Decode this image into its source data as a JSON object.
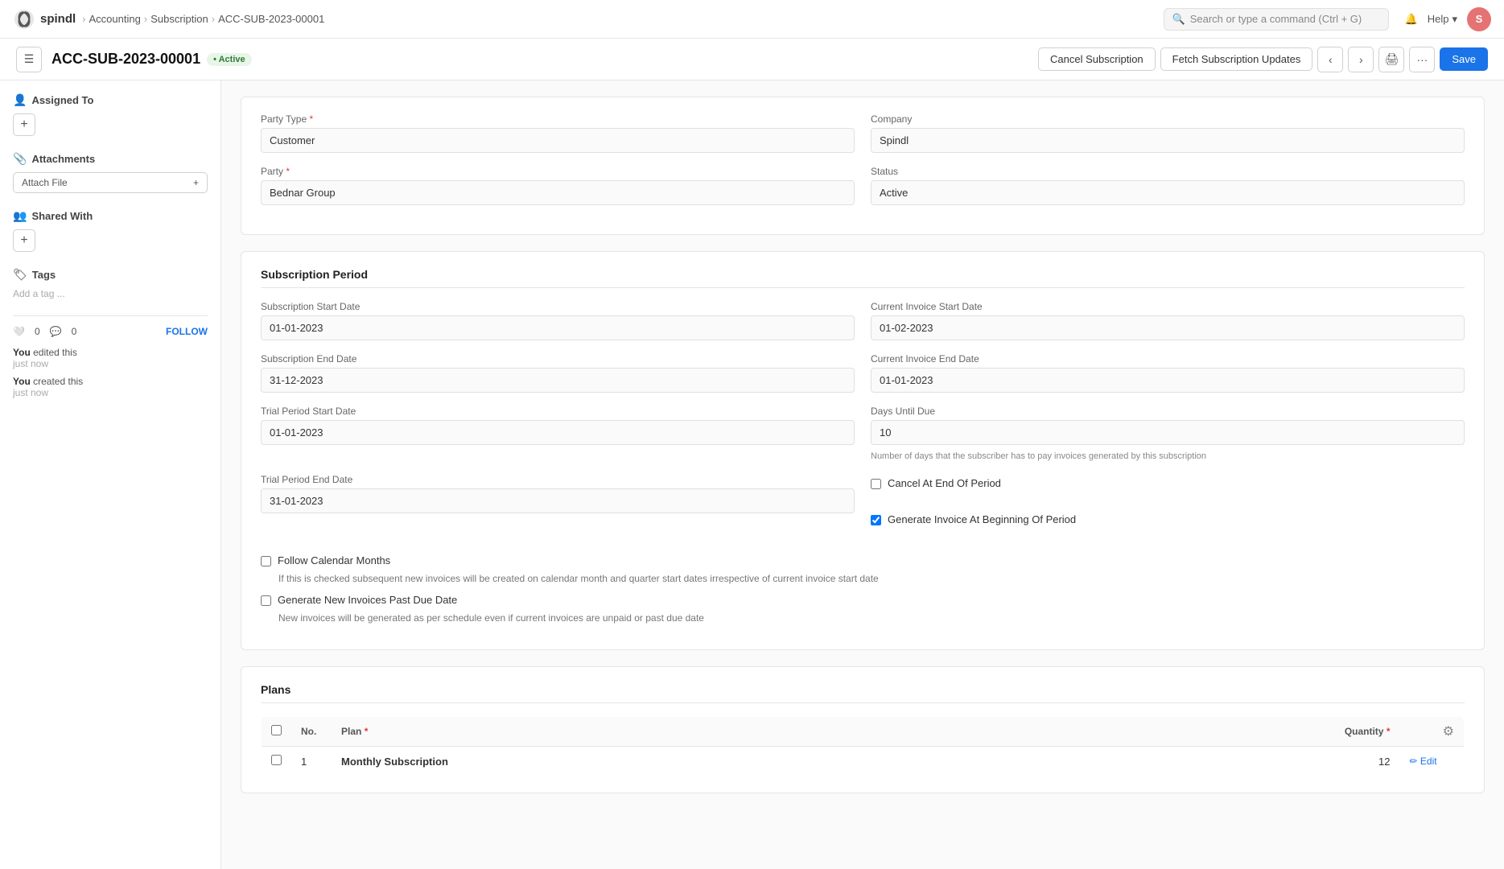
{
  "nav": {
    "logo_text": "spindl",
    "breadcrumbs": [
      "Accounting",
      "Subscription",
      "ACC-SUB-2023-00001"
    ],
    "search_placeholder": "Search or type a command (Ctrl + G)"
  },
  "header": {
    "doc_id": "ACC-SUB-2023-00001",
    "status": "Active",
    "status_dot": "•",
    "cancel_label": "Cancel Subscription",
    "fetch_label": "Fetch Subscription Updates",
    "save_label": "Save",
    "hamburger": "☰"
  },
  "sidebar": {
    "assigned_to_label": "Assigned To",
    "attachments_label": "Attachments",
    "attach_file_label": "Attach File",
    "shared_with_label": "Shared With",
    "tags_label": "Tags",
    "add_tag_placeholder": "Add a tag ...",
    "likes_count": "0",
    "comments_count": "0",
    "follow_label": "FOLLOW",
    "activity": [
      {
        "who": "You",
        "action": "edited this",
        "time": "just now"
      },
      {
        "who": "You",
        "action": "created this",
        "time": "just now"
      }
    ]
  },
  "form": {
    "party_type_label": "Party Type",
    "party_type_value": "Customer",
    "company_label": "Company",
    "company_value": "Spindl",
    "party_label": "Party",
    "party_value": "Bednar Group",
    "status_label": "Status",
    "status_value": "Active",
    "subscription_period_title": "Subscription Period",
    "sub_start_date_label": "Subscription Start Date",
    "sub_start_date_value": "01-01-2023",
    "current_inv_start_label": "Current Invoice Start Date",
    "current_inv_start_value": "01-02-2023",
    "sub_end_date_label": "Subscription End Date",
    "sub_end_date_value": "31-12-2023",
    "current_inv_end_label": "Current Invoice End Date",
    "current_inv_end_value": "01-01-2023",
    "trial_start_label": "Trial Period Start Date",
    "trial_start_value": "01-01-2023",
    "days_until_due_label": "Days Until Due",
    "days_until_due_value": "10",
    "days_until_due_desc": "Number of days that the subscriber has to pay invoices generated by this subscription",
    "trial_end_label": "Trial Period End Date",
    "trial_end_value": "31-01-2023",
    "follow_calendar_label": "Follow Calendar Months",
    "follow_calendar_desc": "If this is checked subsequent new invoices will be created on calendar month and quarter start dates irrespective of current invoice start date",
    "cancel_at_end_label": "Cancel At End Of Period",
    "generate_invoice_label": "Generate Invoice At Beginning Of Period",
    "generate_new_invoices_label": "Generate New Invoices Past Due Date",
    "generate_new_invoices_desc": "New invoices will be generated as per schedule even if current invoices are unpaid or past due date",
    "plans_title": "Plans",
    "plans_col_no": "No.",
    "plans_col_plan": "Plan",
    "plans_col_qty": "Quantity",
    "plans_rows": [
      {
        "no": "1",
        "plan": "Monthly Subscription",
        "qty": "12"
      }
    ]
  }
}
